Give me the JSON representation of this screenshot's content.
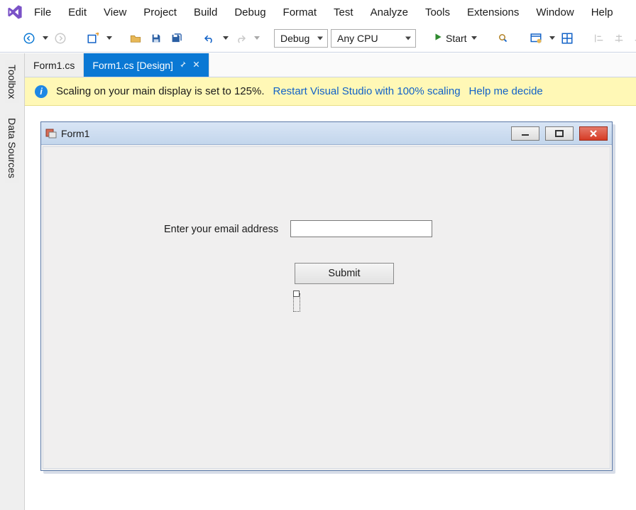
{
  "menu": [
    "File",
    "Edit",
    "View",
    "Project",
    "Build",
    "Debug",
    "Format",
    "Test",
    "Analyze",
    "Tools",
    "Extensions",
    "Window",
    "Help"
  ],
  "toolbar": {
    "config_select": "Debug",
    "platform_select": "Any CPU",
    "start_label": "Start"
  },
  "rail": {
    "toolbox": "Toolbox",
    "datasources": "Data Sources"
  },
  "tabs": {
    "inactive": "Form1.cs",
    "active": "Form1.cs [Design]"
  },
  "infobar": {
    "msg": "Scaling on your main display is set to 125%.",
    "link1": "Restart Visual Studio with 100% scaling",
    "link2": "Help me decide"
  },
  "form": {
    "title": "Form1",
    "label": "Enter your email address",
    "textbox": "",
    "button": "Submit"
  }
}
